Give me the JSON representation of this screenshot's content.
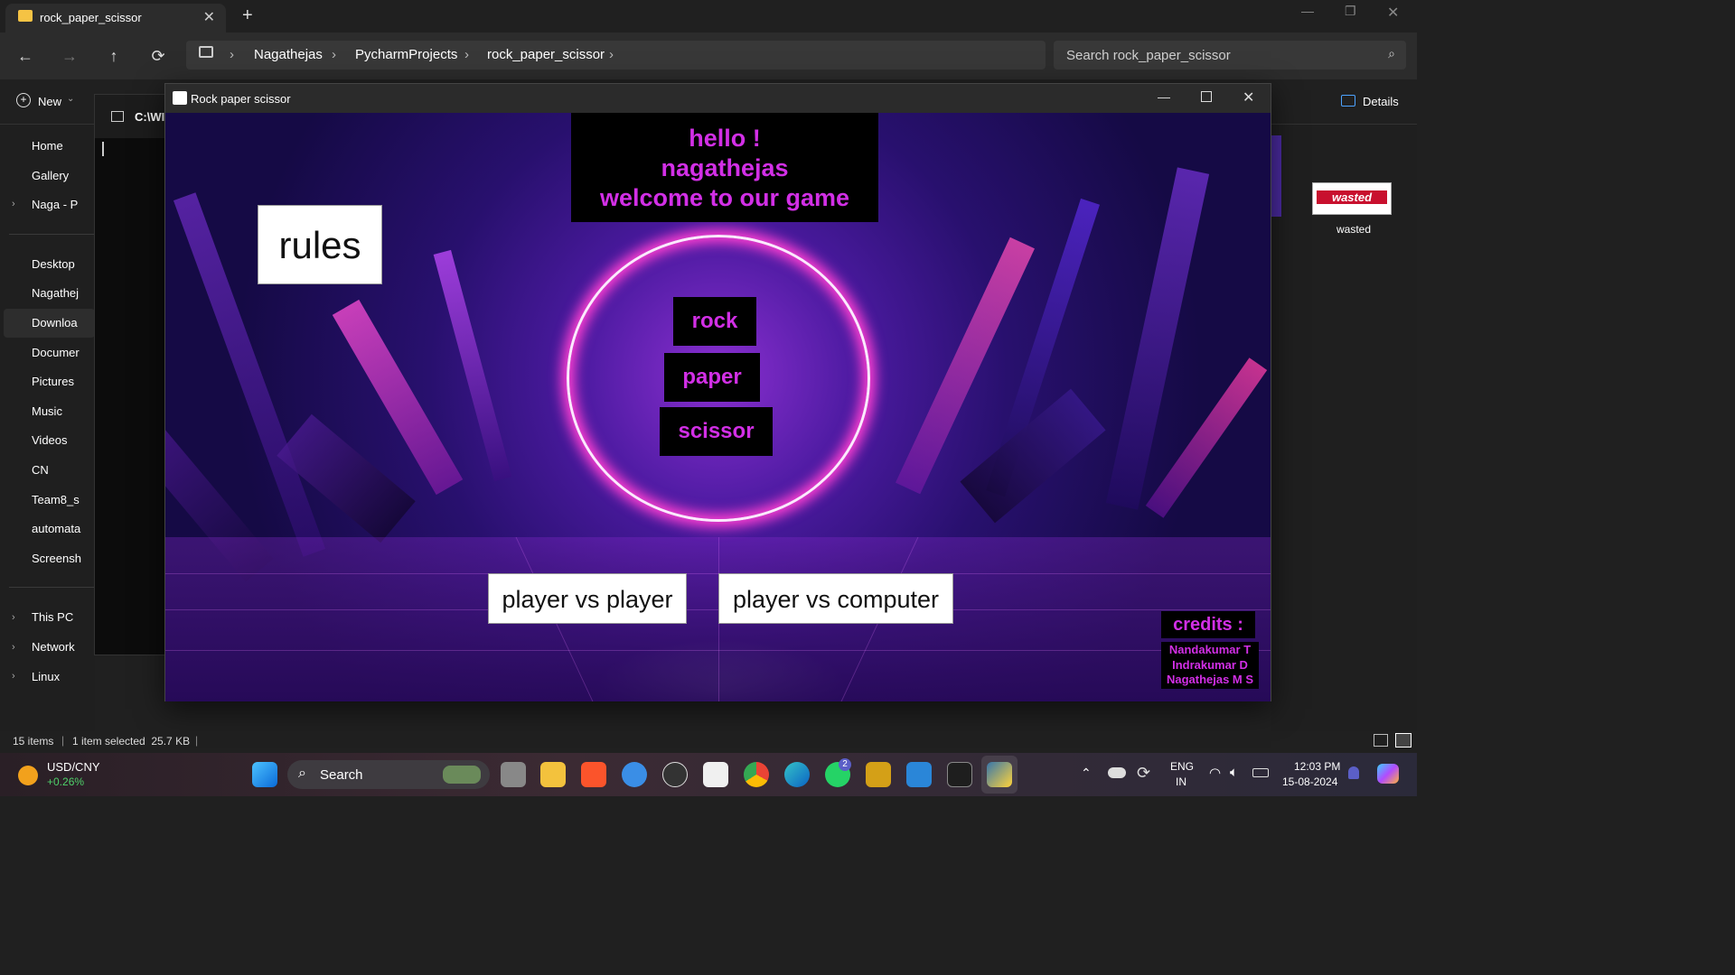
{
  "explorer": {
    "tab_title": "rock_paper_scissor",
    "tab_close": "✕",
    "new_tab": "+",
    "nav": {
      "back": "←",
      "forward": "→",
      "up": "↑",
      "refresh": "⟳"
    },
    "breadcrumb": [
      "Nagathejas",
      "PycharmProjects",
      "rock_paper_scissor"
    ],
    "breadcrumb_sep": "›",
    "search_placeholder": "Search rock_paper_scissor",
    "new_button": "New",
    "details_button": "Details",
    "cmd_title": "C:\\WI",
    "sidebar": [
      {
        "label": "Home",
        "color": "#e07030"
      },
      {
        "label": "Gallery",
        "color": "#3d8fe0"
      },
      {
        "label": "Naga - P",
        "color": "#4da3ff",
        "expand": "›"
      },
      {
        "label": "Desktop",
        "color": "#3aa0e0"
      },
      {
        "label": "Nagathej",
        "color": "#40c0a0"
      },
      {
        "label": "Downloa",
        "color": "#40c070"
      },
      {
        "label": "Documer",
        "color": "#9ab0c8"
      },
      {
        "label": "Pictures",
        "color": "#3d8fe0"
      },
      {
        "label": "Music",
        "color": "#e06050"
      },
      {
        "label": "Videos",
        "color": "#9050e0"
      },
      {
        "label": "CN",
        "color": "#f5c344"
      },
      {
        "label": "Team8_s",
        "color": "#f5c344"
      },
      {
        "label": "automata",
        "color": "#dddddd"
      },
      {
        "label": "Screensh",
        "color": "#f5c344"
      },
      {
        "label": "This PC",
        "color": "#3aa0e0",
        "expand": "›"
      },
      {
        "label": "Network",
        "color": "#3aa0e0",
        "expand": "›"
      },
      {
        "label": "Linux",
        "color": "#f0c040",
        "expand": "›"
      }
    ],
    "status_items": "15 items",
    "status_selected": "1 item selected  25.7 KB",
    "desktop_icon_label": "wasted",
    "desktop_icon_text": "wasted"
  },
  "game": {
    "window_title": "Rock paper scissor",
    "greeting": [
      "hello !",
      "nagathejas",
      "welcome to our game"
    ],
    "rules": "rules",
    "choices": {
      "rock": "rock",
      "paper": "paper",
      "scissor": "scissor"
    },
    "pvp": "player vs player",
    "pvc": "player vs computer",
    "credits_title": "credits :",
    "credits": [
      "Nandakumar T",
      "Indrakumar D",
      "Nagathejas M S"
    ]
  },
  "taskbar": {
    "ticker_symbol": "USD/CNY",
    "ticker_change": "+0.26%",
    "search": "Search",
    "lang": "ENG",
    "region": "IN",
    "time": "12:03 PM",
    "date": "15-08-2024",
    "whatsapp_badge": "2"
  },
  "colors": {
    "game_text": "#d22fe6",
    "ticker_green": "#4fd16a"
  }
}
